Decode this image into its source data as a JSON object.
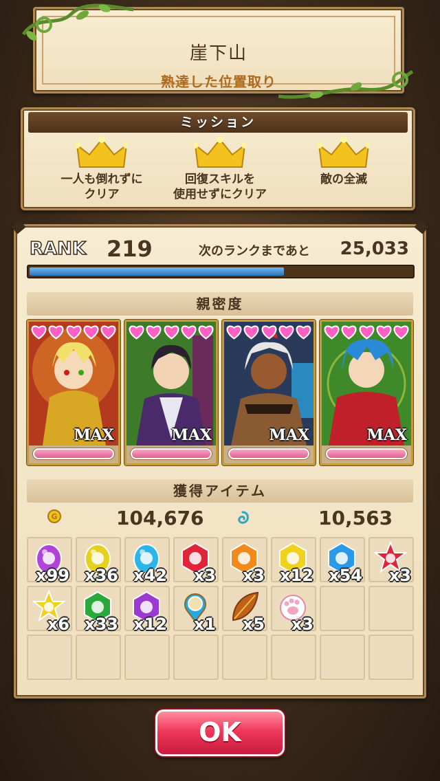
{
  "stage": {
    "name": "崖下山",
    "subtitle": "熟達した位置取り"
  },
  "mission": {
    "title": "ミッション",
    "items": [
      {
        "line1": "一人も倒れずに",
        "line2": "クリア",
        "icon": "crown-icon",
        "cleared": true
      },
      {
        "line1": "回復スキルを",
        "line2": "使用せずにクリア",
        "icon": "crown-icon",
        "cleared": true
      },
      {
        "line1": "敵の全滅",
        "line2": "",
        "icon": "crown-icon",
        "cleared": true
      }
    ]
  },
  "rank": {
    "label": "RANK",
    "value": "219",
    "next_label": "次のランクまであと",
    "next_value": "25,033",
    "progress": 0.66
  },
  "bond": {
    "title": "親密度",
    "cards": [
      {
        "max": "MAX",
        "hearts": 5,
        "theme": "gold-knight",
        "bg": "#b43a1e"
      },
      {
        "max": "MAX",
        "hearts": 5,
        "theme": "purple-haori",
        "bg": "#3d7a2a"
      },
      {
        "max": "MAX",
        "hearts": 5,
        "theme": "white-hair-warrior",
        "bg": "#2a3a5a"
      },
      {
        "max": "MAX",
        "hearts": 5,
        "theme": "blue-hair-red-coat",
        "bg": "#3e8a2a"
      }
    ]
  },
  "drops": {
    "title": "獲得アイテム",
    "gold": "104,676",
    "gold_icon": "coin-icon",
    "spirit": "10,563",
    "spirit_icon": "swirl-icon",
    "items": [
      {
        "icon": "purple-egg-gem-icon",
        "count": "x99",
        "color": "#b044d8"
      },
      {
        "icon": "yellow-egg-gem-icon",
        "count": "x36",
        "color": "#e6d21e"
      },
      {
        "icon": "cyan-egg-gem-icon",
        "count": "x42",
        "color": "#2ab6e8"
      },
      {
        "icon": "red-hex-gem-icon",
        "count": "x3",
        "color": "#e0243a"
      },
      {
        "icon": "orange-hex-gem-icon",
        "count": "x3",
        "color": "#f08a18"
      },
      {
        "icon": "yellow-hex-gem-icon",
        "count": "x12",
        "color": "#f0d21e"
      },
      {
        "icon": "blue-hex-gem-icon",
        "count": "x54",
        "color": "#2a9ae8"
      },
      {
        "icon": "red-star-gem-icon",
        "count": "x3",
        "color": "#e0243a"
      },
      {
        "icon": "yellow-star-gem-icon",
        "count": "x6",
        "color": "#f0d21e"
      },
      {
        "icon": "green-hex-gem-icon",
        "count": "x33",
        "color": "#2aa83a"
      },
      {
        "icon": "purple-hex-gem-icon",
        "count": "x12",
        "color": "#9a3ad0"
      },
      {
        "icon": "blue-orb-key-icon",
        "count": "x1",
        "color": "#2aa6e0"
      },
      {
        "icon": "leaf-feather-icon",
        "count": "x5",
        "color": "#c0601a"
      },
      {
        "icon": "paw-charm-icon",
        "count": "x3",
        "color": "#f3a6c0"
      }
    ]
  },
  "ok_label": "OK"
}
